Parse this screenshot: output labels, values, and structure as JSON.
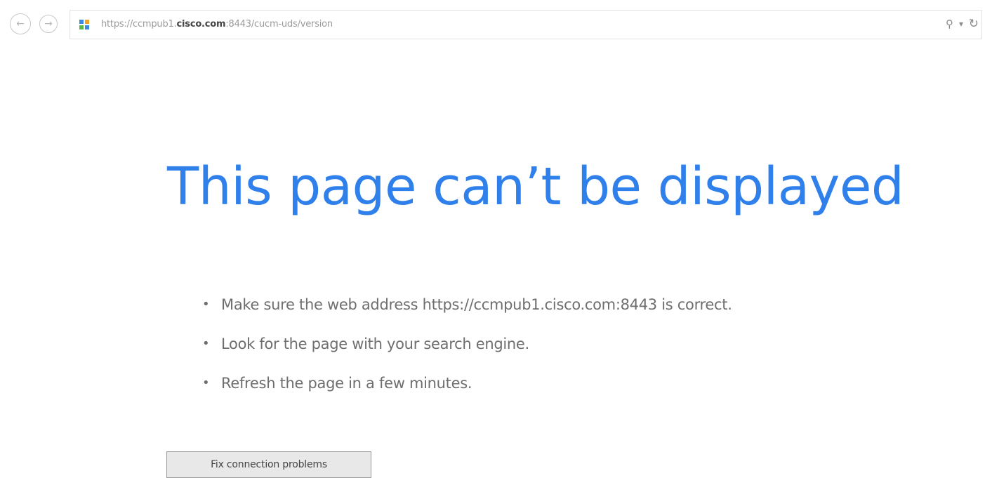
{
  "browser": {
    "back_icon": "back-arrow-icon",
    "forward_icon": "forward-arrow-icon",
    "address": {
      "url_prefix": "https://ccmpub1.",
      "url_domain": "cisco.com",
      "url_suffix": ":8443/cucm-uds/version"
    },
    "search_icon": "search-icon",
    "refresh_icon": "refresh-icon"
  },
  "error": {
    "title": "This page can’t be displayed",
    "suggestions": [
      "Make sure the web address https://ccmpub1.cisco.com:8443 is correct.",
      "Look for the page with your search engine.",
      "Refresh the page in a few minutes."
    ],
    "fix_button_label": "Fix connection problems"
  },
  "colors": {
    "title": "#2f80ea",
    "body_text": "#6e6e6e",
    "url_text": "#9a9a9a"
  }
}
